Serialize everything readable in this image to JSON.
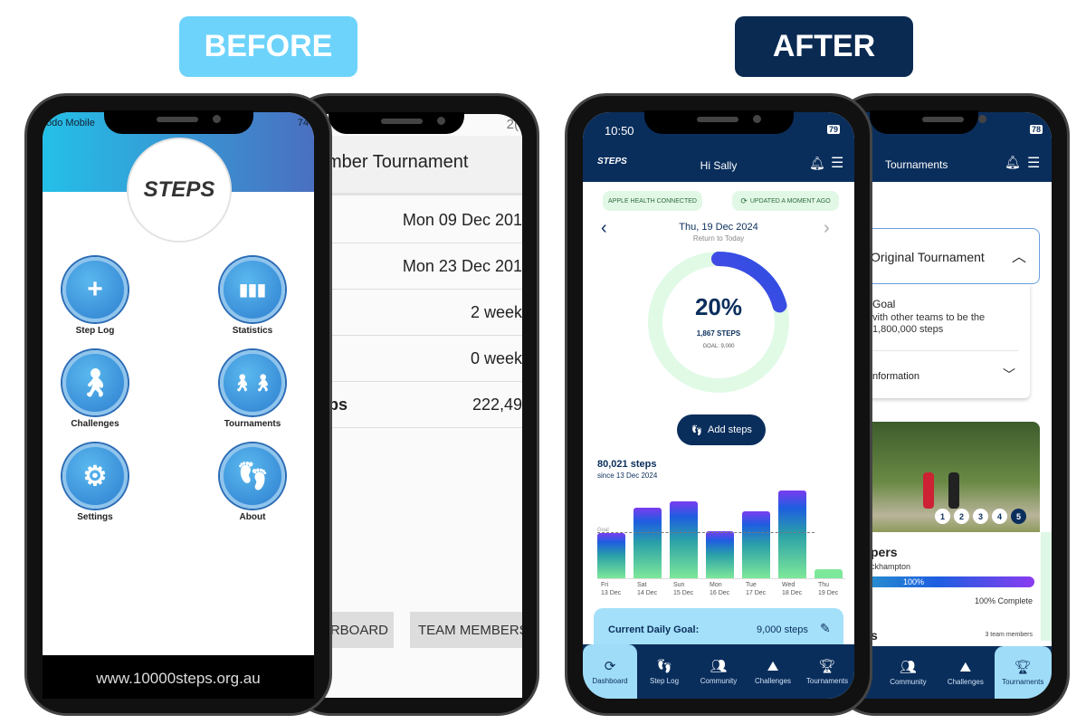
{
  "labels": {
    "before": "BEFORE",
    "after": "AFTER",
    "before_color": "#6dd3fb",
    "after_color": "#0a2a52"
  },
  "old_home": {
    "carrier": "odo Mobile",
    "battery": "74",
    "logo": "10,000 STEPS",
    "footer_url": "www.10000steps.org.au",
    "tiles": [
      {
        "label": "Step Log",
        "icon": "plus-icon"
      },
      {
        "label": "Statistics",
        "icon": "bar-chart-icon"
      },
      {
        "label": "Challenges",
        "icon": "walker-icon"
      },
      {
        "label": "Tournaments",
        "icon": "walkers-icon"
      },
      {
        "label": "Settings",
        "icon": "gear-icon"
      },
      {
        "label": "About",
        "icon": "footprints-icon"
      }
    ]
  },
  "old_tournament": {
    "title": "mber Tournament",
    "status": "2(",
    "rows": [
      {
        "label": "",
        "value": "Mon 09 Dec 201"
      },
      {
        "label": "",
        "value": "Mon 23 Dec 201"
      },
      {
        "label": "",
        "value": "2 week"
      },
      {
        "label": "",
        "value": "0 week"
      },
      {
        "label": "Steps",
        "value": "222,49"
      }
    ],
    "buttons": [
      "RBOARD",
      "TEAM MEMBERS"
    ]
  },
  "dashboard": {
    "time": "10:50",
    "battery": "79",
    "greeting": "Hi Sally",
    "apple_health": "APPLE HEALTH CONNECTED",
    "updated": "UPDATED A MOMENT AGO",
    "date": "Thu, 19 Dec 2024",
    "return_today": "Return to Today",
    "percent": "20%",
    "percent_value": 20.7,
    "steps": "1,867 STEPS",
    "goal": "GOAL: 9,000",
    "add_steps": "Add steps",
    "total_steps": "80,021 steps",
    "since": "since 13 Dec 2024",
    "goal_line_label": "Goal",
    "daily_goal_label": "Current Daily Goal:",
    "daily_goal_value": "9,000 steps",
    "nav": [
      "Dashboard",
      "Step Log",
      "Community",
      "Challenges",
      "Tournaments"
    ]
  },
  "chart_data": {
    "type": "bar",
    "categories": [
      "Fri 13 Dec",
      "Sat 14 Dec",
      "Sun 15 Dec",
      "Mon 16 Dec",
      "Tue 17 Dec",
      "Wed 18 Dec",
      "Thu 19 Dec"
    ],
    "days": [
      "Fri",
      "Sat",
      "Sun",
      "Mon",
      "Tue",
      "Wed",
      "Thu"
    ],
    "dates": [
      "13 Dec",
      "14 Dec",
      "15 Dec",
      "16 Dec",
      "17 Dec",
      "18 Dec",
      "19 Dec"
    ],
    "values": [
      8900,
      13900,
      15200,
      9400,
      13300,
      17454,
      1867
    ],
    "goal": 9000,
    "ylim": [
      0,
      19000
    ]
  },
  "tournaments": {
    "battery": "78",
    "title": "Tournaments",
    "card_title": "Original Tournament",
    "goal_title": "Goal",
    "goal_text1": "vith other teams to be the",
    "goal_text2": "1,800,000 steps",
    "info": "nformation",
    "pager": [
      "1",
      "2",
      "3",
      "4",
      "5"
    ],
    "team_title": "pers",
    "team_sub": "ckhampton",
    "progress": "100%",
    "progress_value": 100,
    "complete": "100% Complete",
    "members_title": "s",
    "members_count": "3 team members",
    "nav": [
      "Community",
      "Challenges",
      "Tournaments"
    ]
  }
}
